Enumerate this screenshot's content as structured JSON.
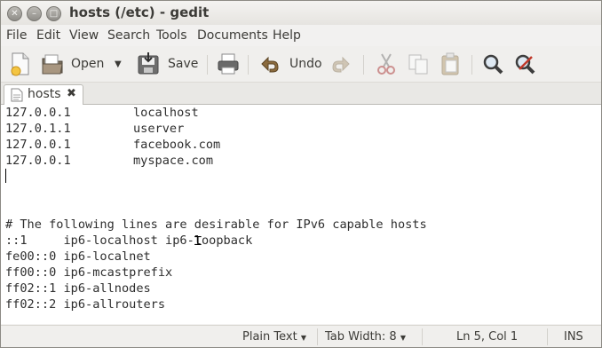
{
  "window": {
    "title": "hosts (/etc) - gedit"
  },
  "menu": [
    "File",
    "Edit",
    "View",
    "Search",
    "Tools",
    "Documents",
    "Help"
  ],
  "toolbar": {
    "open_label": "Open",
    "save_label": "Save",
    "undo_label": "Undo"
  },
  "tab": {
    "label": "hosts"
  },
  "editor": {
    "hosts": [
      {
        "ip": "127.0.0.1",
        "name": "localhost"
      },
      {
        "ip": "127.0.1.1",
        "name": "userver"
      },
      {
        "ip": "127.0.0.1",
        "name": "facebook.com"
      },
      {
        "ip": "127.0.0.1",
        "name": "myspace.com"
      }
    ],
    "comment": "# The following lines are desirable for IPv6 capable hosts",
    "ipv6": [
      "::1     ip6-localhost ip6-loopback",
      "fe00::0 ip6-localnet",
      "ff00::0 ip6-mcastprefix",
      "ff02::1 ip6-allnodes",
      "ff02::2 ip6-allrouters"
    ]
  },
  "status": {
    "language": "Plain Text",
    "tab_width": "Tab Width: 8",
    "position": "Ln 5, Col 1",
    "mode": "INS"
  },
  "icons": {
    "new": "new-document-icon",
    "open": "open-folder-icon",
    "save": "save-icon",
    "print": "print-icon",
    "undo": "undo-icon",
    "redo": "redo-icon",
    "cut": "cut-icon",
    "copy": "copy-icon",
    "paste": "paste-icon",
    "find": "find-icon",
    "replace": "find-replace-icon"
  }
}
